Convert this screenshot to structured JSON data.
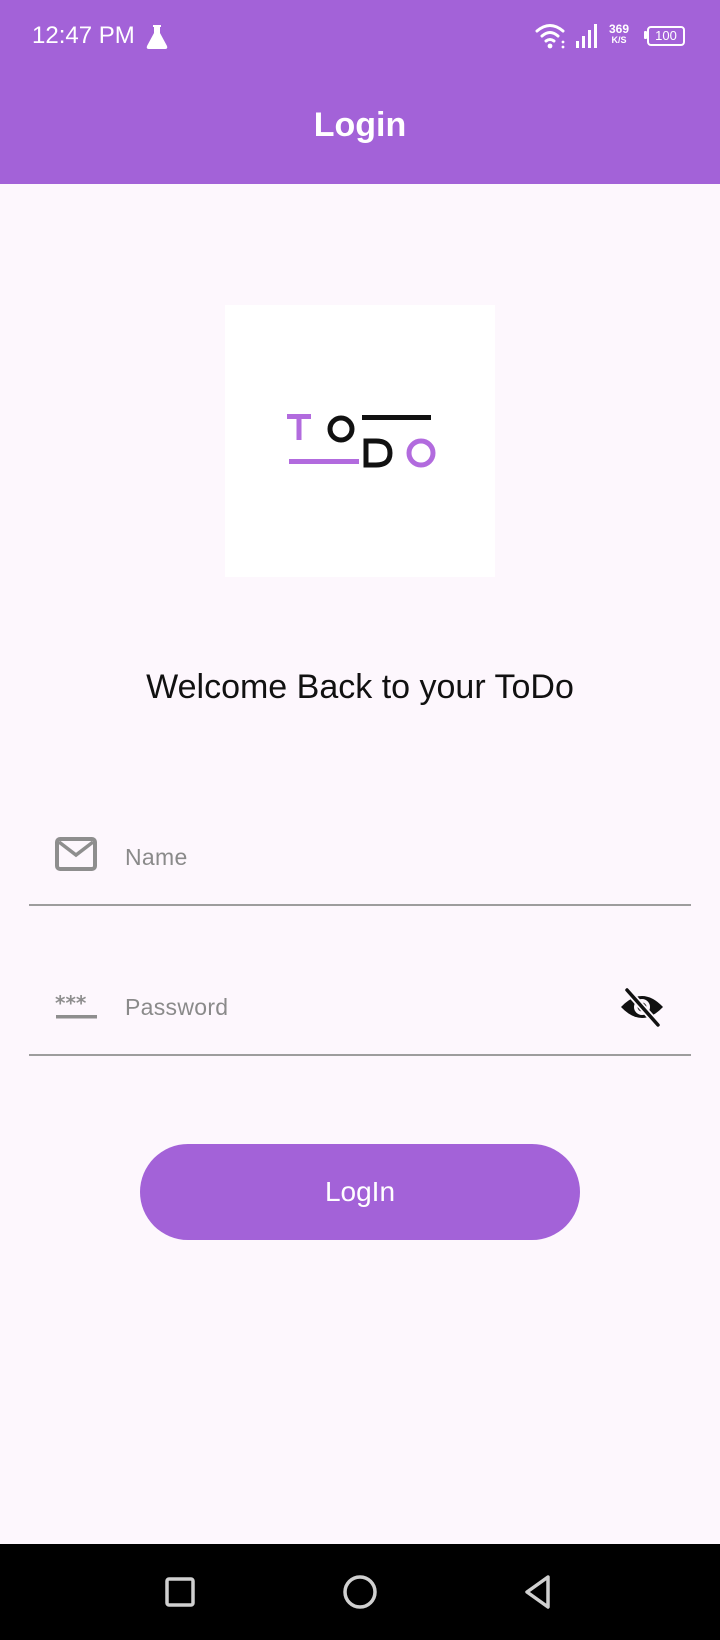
{
  "status_bar": {
    "time": "12:47 PM",
    "speed_value": "369",
    "speed_unit": "K/S",
    "battery": "100",
    "icons": [
      "flask-icon",
      "wifi-icon",
      "signal-icon",
      "battery-icon"
    ]
  },
  "app_bar": {
    "title": "Login"
  },
  "logo": {
    "text": "ToDo",
    "accent_color": "#b26bde",
    "dark_color": "#111111"
  },
  "welcome": "Welcome Back to your ToDo",
  "form": {
    "name_placeholder": "Name",
    "password_placeholder": "Password",
    "login_label": "LogIn"
  },
  "colors": {
    "primary": "#a362d8",
    "background": "#fdf7fd",
    "text_hint": "#8a8a8a",
    "underline": "#9d9d9d"
  },
  "nav_bar": {
    "icons": [
      "recents-icon",
      "home-icon",
      "back-icon"
    ]
  }
}
